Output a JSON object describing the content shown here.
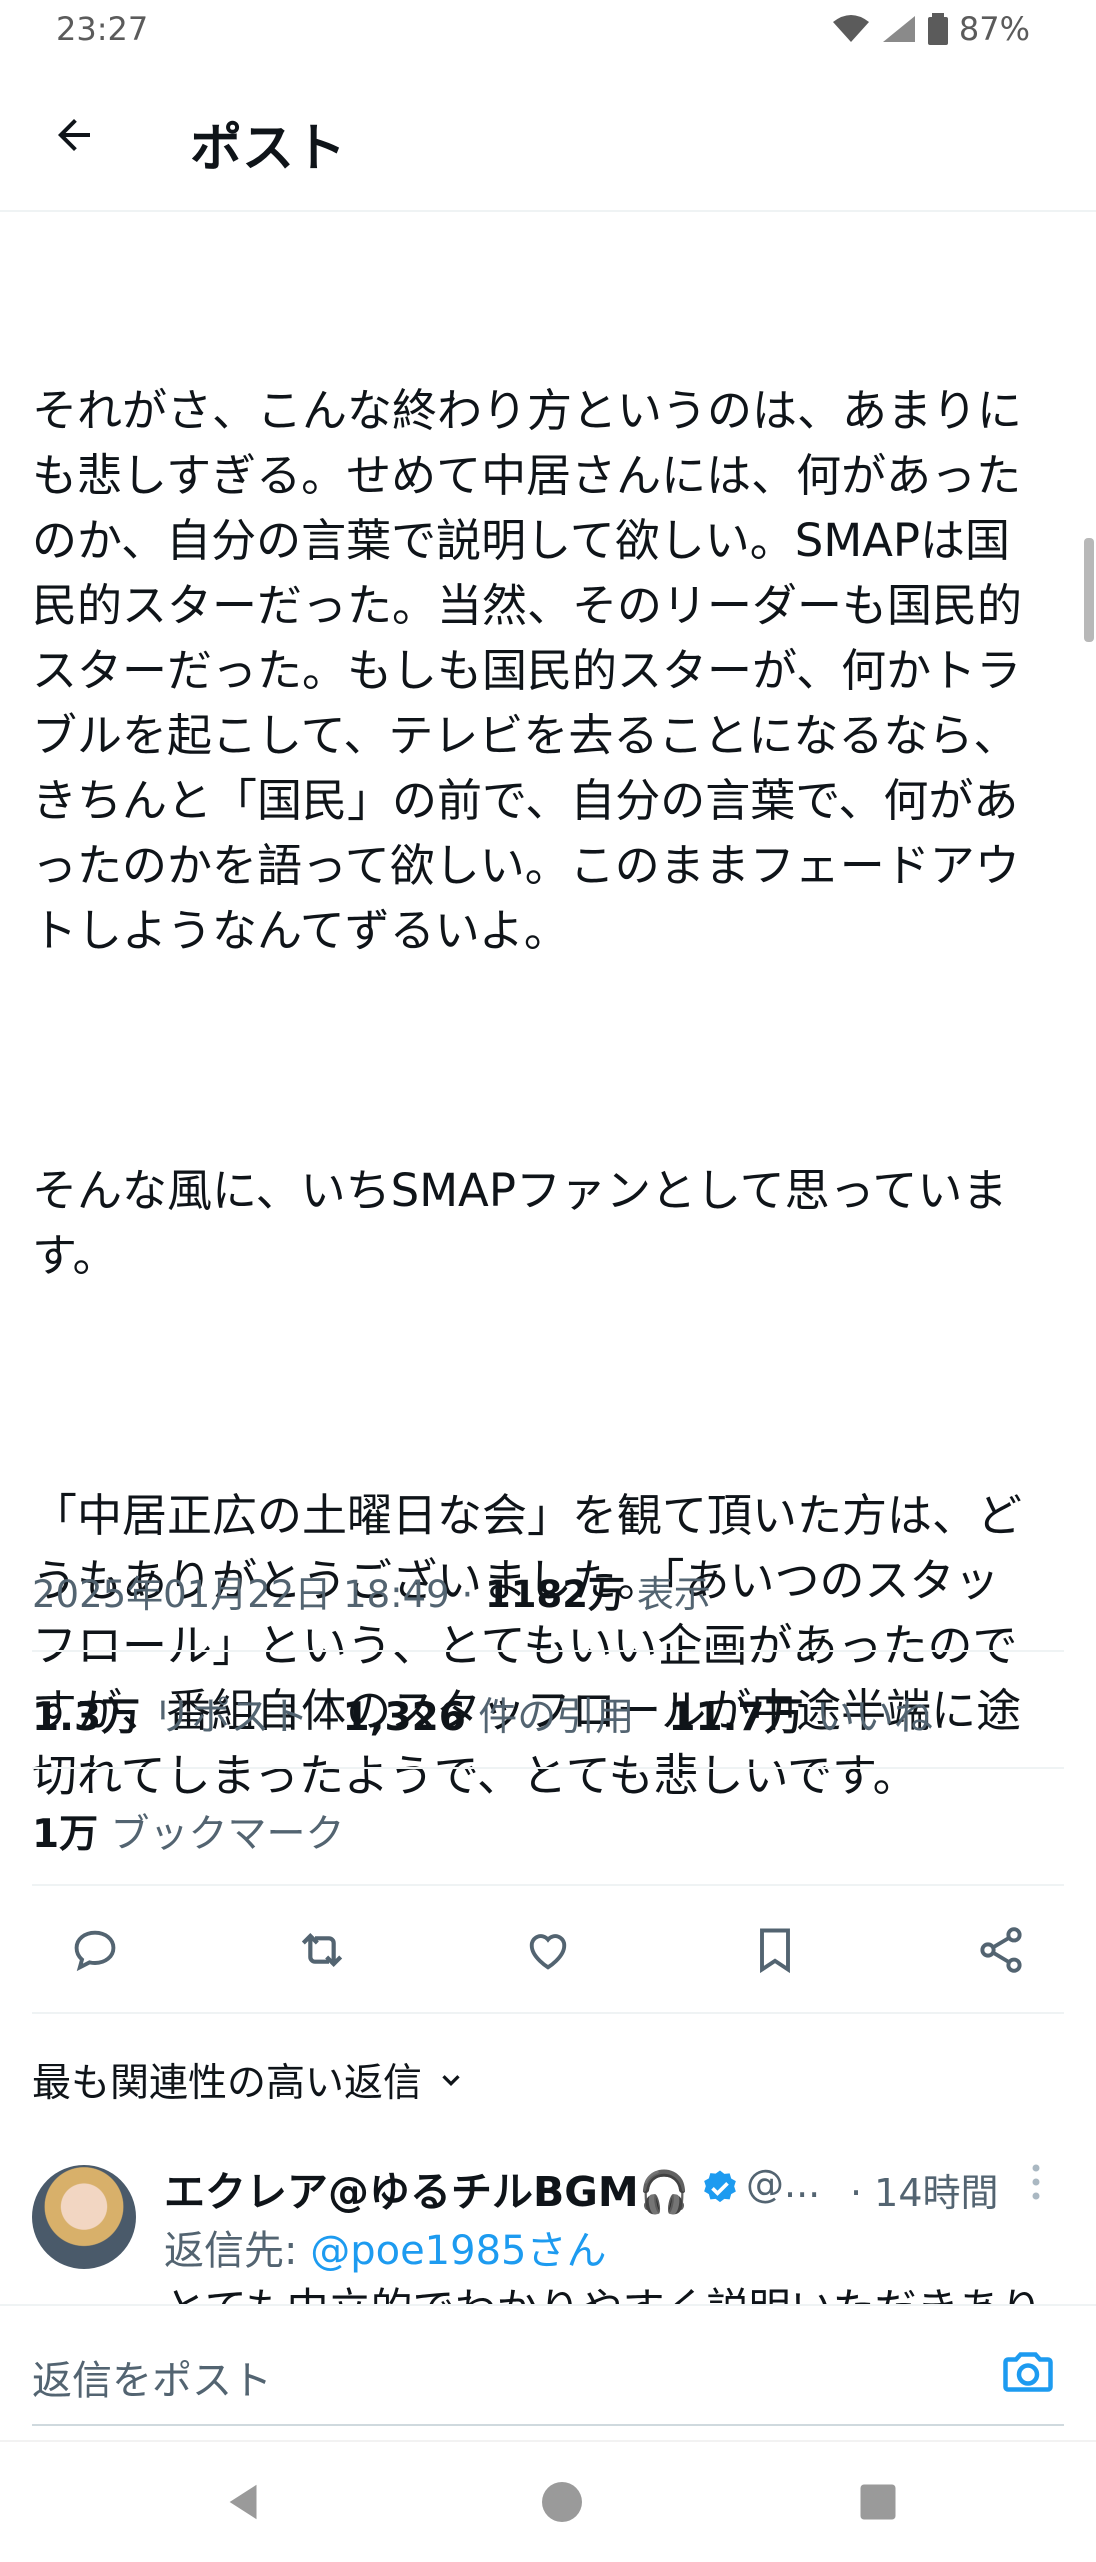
{
  "status_bar": {
    "time": "23:27",
    "battery": "87%"
  },
  "header": {
    "title": "ポスト"
  },
  "post": {
    "paragraphs": [
      "それがさ、こんな終わり方というのは、あまりにも悲しすぎる。せめて中居さんには、何があったのか、自分の言葉で説明して欲しい。SMAPは国民的スターだった。当然、そのリーダーも国民的スターだった。もしも国民的スターが、何かトラブルを起こして、テレビを去ることになるなら、きちんと「国民」の前で、自分の言葉で、何があったのかを語って欲しい。このままフェードアウトしようなんてずるいよ。",
      "そんな風に、いちSMAPファンとして思っています。",
      "「中居正広の土曜日な会」を観て頂いた方は、どうもありがとうございました。「あいつのスタッフロール」という、とてもいい企画があったのですが、番組自体のスタッフロールが中途半端に途切れてしまったようで、とても悲しいです。"
    ],
    "timestamp": "2025年01月22日 18:49",
    "views_count": "1182万",
    "views_label": "表示"
  },
  "stats": {
    "reposts_count": "1.3万",
    "reposts_label": "リポスト",
    "quotes_count": "1,326",
    "quotes_label": "件の引用",
    "likes_count": "11.7万",
    "likes_label": "いいね",
    "bookmarks_count": "1万",
    "bookmarks_label": "ブックマーク"
  },
  "replies_sort": {
    "label": "最も関連性の高い返信"
  },
  "reply": {
    "name": "エクレア@ゆるチルBGM🎧",
    "handle": "@...",
    "time": "· 14時間",
    "reply_to_label": "返信先: ",
    "reply_to_user": "@poe1985さん",
    "preview": "とても中立的でわかりやすく説明いただきあり"
  },
  "compose": {
    "placeholder": "返信をポスト"
  },
  "colors": {
    "accent": "#1d9bf0",
    "text": "#0f1419",
    "muted": "#536471"
  }
}
